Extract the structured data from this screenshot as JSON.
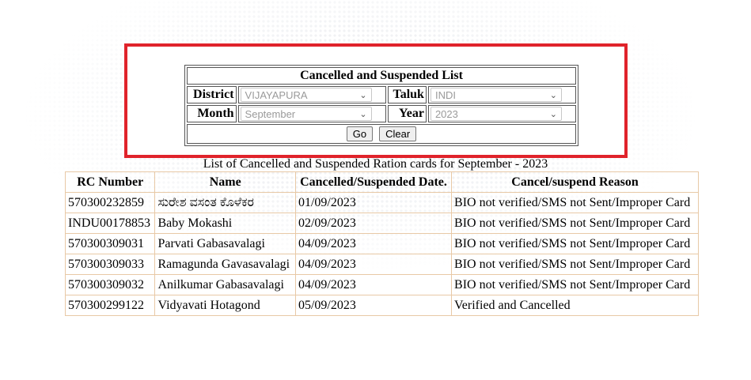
{
  "filter": {
    "title": "Cancelled and Suspended List",
    "district_label": "District",
    "district_value": "VIJAYAPURA",
    "taluk_label": "Taluk",
    "taluk_value": "INDI",
    "month_label": "Month",
    "month_value": "September",
    "year_label": "Year",
    "year_value": "2023",
    "go_label": "Go",
    "clear_label": "Clear"
  },
  "list": {
    "caption": "List of Cancelled and Suspended Ration cards for September - 2023",
    "headers": [
      "RC Number",
      "Name",
      "Cancelled/Suspended Date.",
      "Cancel/suspend Reason"
    ],
    "rows": [
      [
        "570300232859",
        "ಸುರೇಶ ವಸಂತ ಕೊಳೆಕರ",
        "01/09/2023",
        "BIO not verified/SMS not Sent/Improper Card"
      ],
      [
        "INDU00178853",
        "Baby Mokashi",
        "02/09/2023",
        "BIO not verified/SMS not Sent/Improper Card"
      ],
      [
        "570300309031",
        "Parvati Gabasavalagi",
        "04/09/2023",
        "BIO not verified/SMS not Sent/Improper Card"
      ],
      [
        "570300309033",
        "Ramagunda Gavasavalagi",
        "04/09/2023",
        "BIO not verified/SMS not Sent/Improper Card"
      ],
      [
        "570300309032",
        "Anilkumar Gabasavalagi",
        "04/09/2023",
        "BIO not verified/SMS not Sent/Improper Card"
      ],
      [
        "570300299122",
        "Vidyavati Hotagond",
        "05/09/2023",
        "Verified and Cancelled"
      ]
    ]
  },
  "colors": {
    "frame_border": "#e0232b",
    "table_border": "#e8c9a6"
  }
}
